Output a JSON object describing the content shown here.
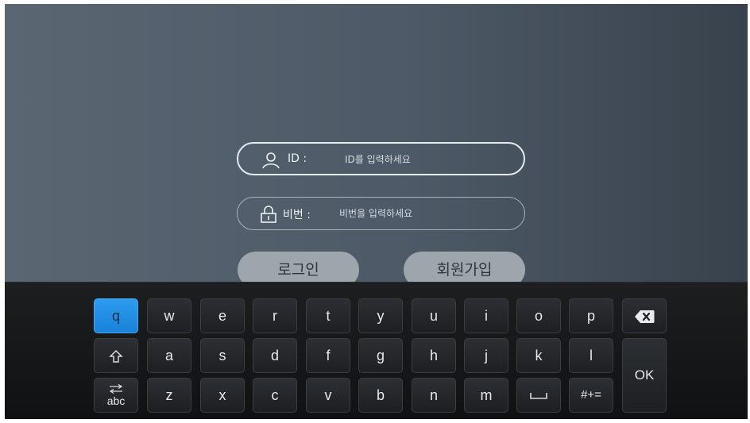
{
  "login_form": {
    "id_label": "ID :",
    "id_placeholder": "ID를 입력하세요",
    "password_label": "비번 :",
    "password_placeholder": "비번을 입력하세요"
  },
  "buttons": {
    "login": "로그인",
    "signup": "회원가입"
  },
  "keyboard": {
    "rows": [
      [
        "q",
        "w",
        "e",
        "r",
        "t",
        "y",
        "u",
        "i",
        "o",
        "p"
      ],
      [
        "a",
        "s",
        "d",
        "f",
        "g",
        "h",
        "j",
        "k",
        "l"
      ],
      [
        "z",
        "x",
        "c",
        "v",
        "b",
        "n",
        "m"
      ]
    ],
    "selected_key": "q",
    "mode_key_label": "abc",
    "symbols_key_label": "#+=",
    "ok_label": "OK",
    "icons": {
      "backspace": "backspace-icon",
      "shift": "shift-icon",
      "switch": "switch-arrows-icon",
      "space": "space-icon"
    }
  },
  "colors": {
    "selected_key": "#1f8fe6",
    "background": "#4d5966",
    "keyboard_bg": "#151618",
    "pill_button": "#9ea6ad"
  }
}
